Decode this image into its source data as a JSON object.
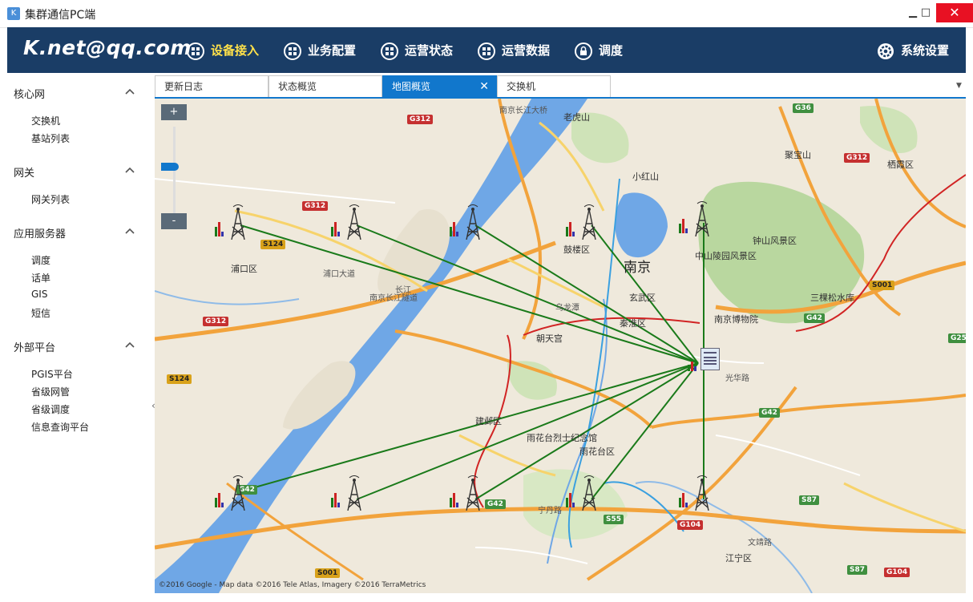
{
  "window": {
    "title": "集群通信PC端",
    "minimize": "▁",
    "maximize": "□",
    "close": "✕",
    "app_icon": "K"
  },
  "brand": "K.net@qq.com",
  "nav": [
    {
      "label": "设备接入",
      "icon": "grid-icon",
      "active": true
    },
    {
      "label": "业务配置",
      "icon": "grid-icon",
      "active": false
    },
    {
      "label": "运营状态",
      "icon": "grid-icon",
      "active": false
    },
    {
      "label": "运营数据",
      "icon": "grid-icon",
      "active": false
    },
    {
      "label": "调度",
      "icon": "lock-icon",
      "active": false
    },
    {
      "label": "系统设置",
      "icon": "gear-icon",
      "active": false
    }
  ],
  "sidebar": {
    "groups": [
      {
        "title": "核心网",
        "items": [
          "交换机",
          "基站列表"
        ]
      },
      {
        "title": "网关",
        "items": [
          "网关列表"
        ]
      },
      {
        "title": "应用服务器",
        "items": [
          "调度",
          "话单",
          "GIS",
          "短信"
        ]
      },
      {
        "title": "外部平台",
        "items": [
          "PGIS平台",
          "省级网管",
          "省级调度",
          "信息查询平台"
        ]
      }
    ],
    "collapse_arrow": "‹"
  },
  "tabs": [
    {
      "label": "更新日志",
      "active": false
    },
    {
      "label": "状态概览",
      "active": false
    },
    {
      "label": "地图概览",
      "active": true,
      "close": "✕"
    },
    {
      "label": "交换机",
      "active": false
    }
  ],
  "tab_dropdown": "▼",
  "map": {
    "zoom_in": "+",
    "zoom_out": "-",
    "zoom_level": 0.55,
    "copyright": "©2016 Google - Map data ©2016 Tele Atlas, Imagery ©2016 TerraMetrics",
    "labels": {
      "nanjing": "南京",
      "pukou": "浦口区",
      "gulou": "鼓楼区",
      "xuanwu": "玄武区",
      "qinhuai": "秦淮区",
      "jianye": "建邺区",
      "yuhuatai": "雨花台区",
      "jiangning": "江宁区",
      "laohushan": "老虎山",
      "xiaohongshan": "小红山",
      "jubaoshan": "聚宝山",
      "zhongshan": "钟山风景区",
      "zhongshanling": "中山陵园风景区",
      "museum": "南京博物院",
      "sankesongshui": "三棵松水库",
      "chaotiangong": "朝天宫",
      "yuhuatai_memorial": "雨花台烈士纪念馆",
      "qixia": "栖霞区",
      "wulongtan": "乌龙潭",
      "changjiang": "长江",
      "nanjing_changjiang_bridge": "南京长江大桥",
      "pukou_avenue": "浦口大道",
      "yangtze_tunnel": "南京长江隧道",
      "guangzhoulu": "光华路",
      "ningdanlu": "宁丹路",
      "wenjinglu": "文靖路"
    },
    "shields": [
      {
        "text": "G36",
        "type": "g"
      },
      {
        "text": "G312",
        "type": "r"
      },
      {
        "text": "G312",
        "type": "r"
      },
      {
        "text": "G312",
        "type": "r"
      },
      {
        "text": "S124",
        "type": "y"
      },
      {
        "text": "S124",
        "type": "y"
      },
      {
        "text": "G312",
        "type": "r"
      },
      {
        "text": "S001",
        "type": "y"
      },
      {
        "text": "G42",
        "type": "g"
      },
      {
        "text": "G25",
        "type": "g"
      },
      {
        "text": "G42",
        "type": "g"
      },
      {
        "text": "G42",
        "type": "g"
      },
      {
        "text": "G42",
        "type": "g"
      },
      {
        "text": "S55",
        "type": "g"
      },
      {
        "text": "G104",
        "type": "r"
      },
      {
        "text": "S87",
        "type": "g"
      },
      {
        "text": "S87",
        "type": "g"
      },
      {
        "text": "G104",
        "type": "r"
      },
      {
        "text": "S001",
        "type": "y"
      }
    ],
    "colors": {
      "river": "#6fa7e6",
      "land": "#efe9dc",
      "park": "#b9d79f",
      "highway": "#f2a33c",
      "link": "#1a7a1a",
      "rail": "#d12424",
      "metro": "#3aa0e0"
    }
  }
}
